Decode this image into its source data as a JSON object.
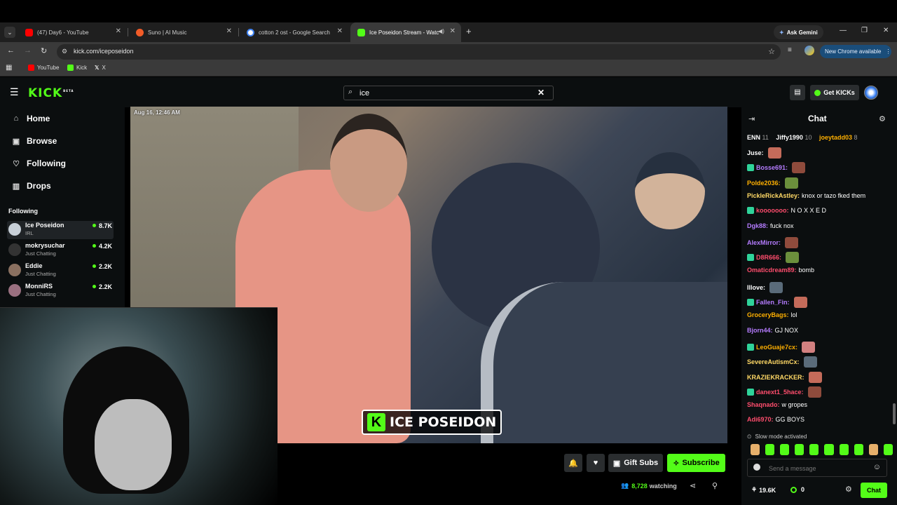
{
  "browser": {
    "tabs": [
      {
        "title": "(47) Day6 - YouTube",
        "color": "#ff0000"
      },
      {
        "title": "Suno | AI Music",
        "color": "#f25c28"
      },
      {
        "title": "cotton 2 ost - Google Search",
        "color": "#4285f4"
      },
      {
        "title": "Ice Poseidon Stream - Watc",
        "color": "#53fc18"
      }
    ],
    "url": "kick.com/iceposeidon",
    "ask_gemini": "Ask Gemini",
    "new_chrome": "New Chrome available",
    "bookmarks": [
      "YouTube",
      "Kick",
      "X"
    ]
  },
  "kick": {
    "logo": "KICK",
    "logo_beta": "BETA",
    "search_value": "ice",
    "get_kicks": "Get KICKs"
  },
  "sidebar": {
    "nav": [
      "Home",
      "Browse",
      "Following",
      "Drops"
    ],
    "following_heading": "Following",
    "channels": [
      {
        "name": "Ice Poseidon",
        "category": "IRL",
        "viewers": "8.7K"
      },
      {
        "name": "mokrysuchar",
        "category": "Just Chatting",
        "viewers": "4.2K"
      },
      {
        "name": "Eddie",
        "category": "Just Chatting",
        "viewers": "2.2K"
      },
      {
        "name": "MonniRS",
        "category": "Just Chatting",
        "viewers": "2.2K"
      }
    ]
  },
  "video": {
    "timestamp": "Aug 16, 12:46 AM",
    "overlay_logo": "ICE POSEIDON"
  },
  "actions": {
    "gift_subs": "Gift Subs",
    "subscribe": "Subscribe",
    "watching_count": "8,728",
    "watching_label": "watching"
  },
  "chat": {
    "title": "Chat",
    "leaderboard": [
      {
        "name": "ENN",
        "count": "11"
      },
      {
        "name": "Jiffy1990",
        "count": "10"
      },
      {
        "name": "joeytadd03",
        "count": "8"
      }
    ],
    "messages": [
      {
        "user": "Juse:",
        "color": "#ffffff",
        "text": ""
      },
      {
        "user": "Bosse691:",
        "color": "#b57cff",
        "text": ""
      },
      {
        "user": "Polde2036:",
        "color": "#ffb000",
        "text": ""
      },
      {
        "user": "PickleRickAstley:",
        "color": "#ffd966",
        "text": "knox or tazo fked them"
      },
      {
        "user": "kooooooo:",
        "color": "#ff4d6d",
        "text": "N O X X E D"
      },
      {
        "user": "Dgk88:",
        "color": "#b57cff",
        "text": "fuck nox"
      },
      {
        "user": "AlexMirror:",
        "color": "#b57cff",
        "text": ""
      },
      {
        "user": "D8R666:",
        "color": "#ff4d6d",
        "text": ""
      },
      {
        "user": "Omaticdream89:",
        "color": "#ff4d6d",
        "text": "bomb"
      },
      {
        "user": "Illove:",
        "color": "#ffffff",
        "text": ""
      },
      {
        "user": "Fallen_Fin:",
        "color": "#b57cff",
        "text": ""
      },
      {
        "user": "GroceryBags:",
        "color": "#ffb000",
        "text": "lol"
      },
      {
        "user": "Bjorn44:",
        "color": "#b57cff",
        "text": "GJ NOX"
      },
      {
        "user": "LeoGuaje7cx:",
        "color": "#ffb000",
        "text": ""
      },
      {
        "user": "SevereAutismCx:",
        "color": "#ffd966",
        "text": ""
      },
      {
        "user": "KRAZIEKRACKER:",
        "color": "#ffd966",
        "text": ""
      },
      {
        "user": "danext1_5hace:",
        "color": "#ff4d6d",
        "text": ""
      },
      {
        "user": "Shaqnado:",
        "color": "#ff4d6d",
        "text": "w gropes"
      },
      {
        "user": "Adi6970:",
        "color": "#ff4d6d",
        "text": "GG BOYS"
      }
    ],
    "slow_mode": "Slow mode activated",
    "input_placeholder": "Send a message",
    "points": "19.6K",
    "kicks": "0",
    "send_button": "Chat"
  },
  "colors": {
    "accent": "#53fc18",
    "panel": "#0b0e0f"
  }
}
